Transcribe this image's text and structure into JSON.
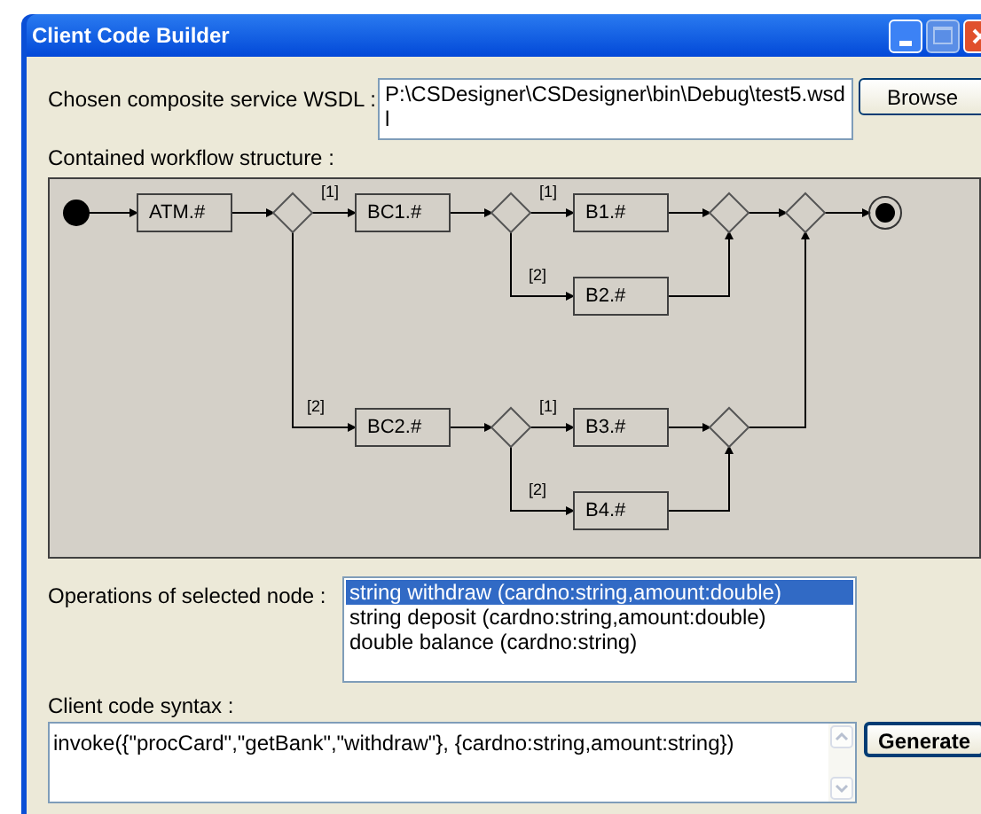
{
  "window": {
    "title": "Client Code Builder"
  },
  "wsdl": {
    "label": "Chosen composite service WSDL :",
    "value": "P:\\CSDesigner\\CSDesigner\\bin\\Debug\\test5.wsdl",
    "button": "Browse"
  },
  "workflow": {
    "label": "Contained workflow structure :",
    "nodes": [
      {
        "kind": "start"
      },
      {
        "kind": "task",
        "label": "ATM.#"
      },
      {
        "kind": "decision"
      },
      {
        "kind": "task",
        "label": "BC1.#"
      },
      {
        "kind": "decision"
      },
      {
        "kind": "task",
        "label": "B1.#"
      },
      {
        "kind": "task",
        "label": "B2.#"
      },
      {
        "kind": "decision"
      },
      {
        "kind": "decision"
      },
      {
        "kind": "end"
      },
      {
        "kind": "task",
        "label": "BC2.#"
      },
      {
        "kind": "decision"
      },
      {
        "kind": "task",
        "label": "B3.#"
      },
      {
        "kind": "task",
        "label": "B4.#"
      },
      {
        "kind": "decision"
      }
    ],
    "guards": [
      "[1]",
      "[2]",
      "[1]",
      "[2]",
      "[1]",
      "[2]"
    ]
  },
  "operations": {
    "label": "Operations of selected node :",
    "items": [
      {
        "text": "string withdraw (cardno:string,amount:double)",
        "selected": true
      },
      {
        "text": "string deposit (cardno:string,amount:double)",
        "selected": false
      },
      {
        "text": "double balance (cardno:string)",
        "selected": false
      }
    ]
  },
  "code": {
    "label": "Client code syntax :",
    "value": "invoke({\"procCard\",\"getBank\",\"withdraw\"}, {cardno:string,amount:string})",
    "button": "Generate"
  }
}
